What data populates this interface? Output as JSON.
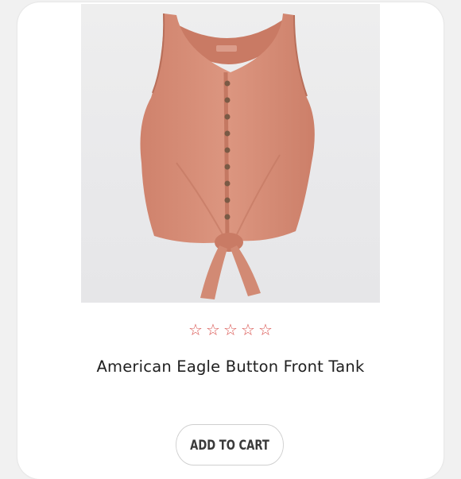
{
  "product": {
    "name": "American Eagle Button Front Tank",
    "image_icon": "tank-top-image",
    "colors": {
      "garment": "#d88f78",
      "rating_star": "#d9534f"
    }
  },
  "rating": {
    "stars": [
      "☆",
      "☆",
      "☆",
      "☆",
      "☆"
    ],
    "value": 0,
    "max": 5
  },
  "actions": {
    "add_to_cart_label": "ADD TO CART"
  }
}
